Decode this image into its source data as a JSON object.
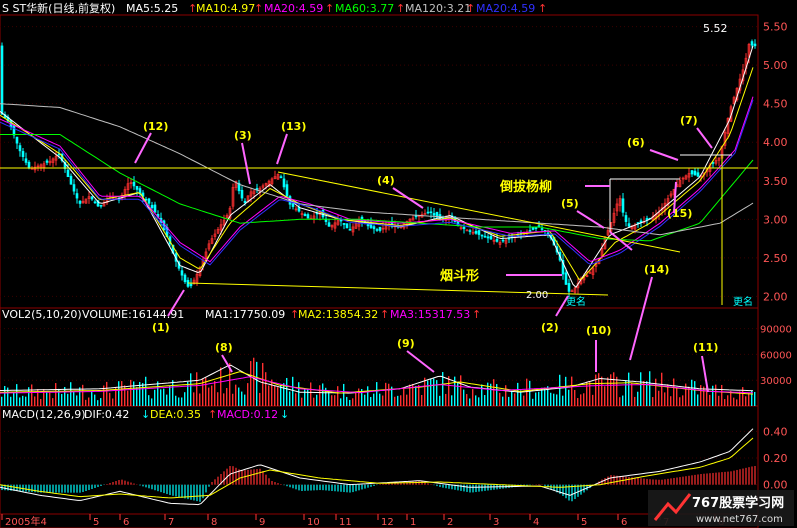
{
  "header": {
    "stock_name": "S ST华新(日线,前复权)",
    "ma5": "MA5:5.25",
    "ma10": "MA10:4.97",
    "ma20": "MA20:4.59",
    "ma60": "MA60:3.77",
    "ma120": "MA120:3.21",
    "ma20b": "MA20:4.59",
    "colors": {
      "ma5": "#ffffff",
      "ma10": "#ffff00",
      "ma20": "#ff00ff",
      "ma60": "#00ff00",
      "ma120": "#c0c0c0",
      "ma20b": "#0000ff",
      "arrow": "#ff3333"
    }
  },
  "volume_header": {
    "vol": "VOL2(5,10,20)",
    "volume": "VOLUME:16144.91",
    "ma1": "MA1:17750.09",
    "ma2": "MA2:13854.32",
    "ma3": "MA3:15317.53"
  },
  "macd_header": {
    "macd": "MACD(12,26,9)",
    "dif": "DIF:0.42",
    "dea": "DEA:0.35",
    "val": "MACD:0.12"
  },
  "annotations": {
    "a1": "(1)",
    "a2": "(2)",
    "a3": "(3)",
    "a4": "(4)",
    "a5": "(5)",
    "a6": "(6)",
    "a7": "(7)",
    "a8": "(8)",
    "a9": "(9)",
    "a10": "(10)",
    "a11": "(11)",
    "a12": "(12)",
    "a13": "(13)",
    "a14": "(14)",
    "a15": "(15)",
    "daobayangliu": "倒拔杨柳",
    "yandouxing": "烟斗形",
    "gengming": "更名",
    "low_label": "2.00",
    "high_label": "5.52"
  },
  "watermark": {
    "name": "767股票学习网",
    "url": "www.net767.com"
  },
  "chart_data": [
    {
      "type": "candlestick",
      "title": "S ST华新(日线,前复权)",
      "y_ticks": [
        "5.50",
        "5.00",
        "4.50",
        "4.00",
        "3.50",
        "3.00",
        "2.50",
        "2.00"
      ],
      "ylim": [
        1.85,
        5.65
      ],
      "x_ticks": [
        "2005年4",
        "5",
        "6",
        "7",
        "8",
        "9",
        "10",
        "11",
        "12",
        "1",
        "2",
        "3",
        "4",
        "5",
        "6",
        "7",
        "8"
      ],
      "price_path": [
        [
          0,
          4.4
        ],
        [
          10,
          4.25
        ],
        [
          20,
          3.9
        ],
        [
          30,
          3.65
        ],
        [
          40,
          3.7
        ],
        [
          50,
          3.75
        ],
        [
          60,
          3.85
        ],
        [
          70,
          3.5
        ],
        [
          80,
          3.2
        ],
        [
          90,
          3.3
        ],
        [
          100,
          3.15
        ],
        [
          110,
          3.3
        ],
        [
          120,
          3.25
        ],
        [
          130,
          3.5
        ],
        [
          140,
          3.35
        ],
        [
          150,
          3.2
        ],
        [
          160,
          3.0
        ],
        [
          170,
          2.7
        ],
        [
          175,
          2.5
        ],
        [
          180,
          2.35
        ],
        [
          185,
          2.2
        ],
        [
          190,
          2.1
        ],
        [
          200,
          2.35
        ],
        [
          210,
          2.7
        ],
        [
          220,
          2.9
        ],
        [
          230,
          3.1
        ],
        [
          235,
          3.55
        ],
        [
          240,
          3.35
        ],
        [
          245,
          3.2
        ],
        [
          250,
          3.35
        ],
        [
          260,
          3.4
        ],
        [
          270,
          3.5
        ],
        [
          280,
          3.6
        ],
        [
          290,
          3.2
        ],
        [
          300,
          3.1
        ],
        [
          310,
          3.0
        ],
        [
          320,
          3.1
        ],
        [
          330,
          2.9
        ],
        [
          340,
          3.0
        ],
        [
          350,
          2.85
        ],
        [
          360,
          3.0
        ],
        [
          370,
          2.9
        ],
        [
          380,
          2.85
        ],
        [
          390,
          2.95
        ],
        [
          400,
          2.9
        ],
        [
          410,
          3.0
        ],
        [
          420,
          3.05
        ],
        [
          430,
          3.1
        ],
        [
          440,
          3.0
        ],
        [
          450,
          3.05
        ],
        [
          460,
          2.9
        ],
        [
          470,
          2.85
        ],
        [
          480,
          2.8
        ],
        [
          490,
          2.75
        ],
        [
          500,
          2.7
        ],
        [
          510,
          2.75
        ],
        [
          520,
          2.8
        ],
        [
          530,
          2.85
        ],
        [
          540,
          2.9
        ],
        [
          550,
          2.8
        ],
        [
          560,
          2.5
        ],
        [
          565,
          2.2
        ],
        [
          570,
          2.05
        ],
        [
          575,
          2.1
        ],
        [
          580,
          2.2
        ],
        [
          590,
          2.3
        ],
        [
          600,
          2.5
        ],
        [
          605,
          2.75
        ],
        [
          610,
          2.9
        ],
        [
          615,
          3.1
        ],
        [
          620,
          3.3
        ],
        [
          625,
          3.0
        ],
        [
          630,
          2.9
        ],
        [
          640,
          2.95
        ],
        [
          650,
          3.0
        ],
        [
          660,
          3.1
        ],
        [
          670,
          3.3
        ],
        [
          680,
          3.5
        ],
        [
          690,
          3.6
        ],
        [
          700,
          3.55
        ],
        [
          705,
          3.6
        ],
        [
          710,
          3.7
        ],
        [
          720,
          3.8
        ],
        [
          725,
          4.1
        ],
        [
          730,
          4.4
        ],
        [
          735,
          4.6
        ],
        [
          740,
          4.8
        ],
        [
          745,
          5.0
        ],
        [
          750,
          5.3
        ],
        [
          753,
          5.25
        ]
      ],
      "moving_averages": [
        {
          "name": "MA5",
          "path": [
            [
              0,
              4.4
            ],
            [
              60,
              3.8
            ],
            [
              100,
              3.2
            ],
            [
              140,
              3.35
            ],
            [
              180,
              2.4
            ],
            [
              200,
              2.3
            ],
            [
              230,
              3.05
            ],
            [
              270,
              3.45
            ],
            [
              300,
              3.15
            ],
            [
              340,
              3.0
            ],
            [
              400,
              2.9
            ],
            [
              450,
              3.05
            ],
            [
              500,
              2.75
            ],
            [
              550,
              2.8
            ],
            [
              575,
              2.1
            ],
            [
              610,
              2.8
            ],
            [
              650,
              3.0
            ],
            [
              700,
              3.55
            ],
            [
              730,
              4.3
            ],
            [
              753,
              5.25
            ]
          ]
        },
        {
          "name": "MA10",
          "path": [
            [
              0,
              4.35
            ],
            [
              60,
              3.85
            ],
            [
              100,
              3.25
            ],
            [
              140,
              3.35
            ],
            [
              180,
              2.5
            ],
            [
              200,
              2.35
            ],
            [
              230,
              2.95
            ],
            [
              270,
              3.4
            ],
            [
              300,
              3.2
            ],
            [
              340,
              3.0
            ],
            [
              400,
              2.92
            ],
            [
              450,
              3.02
            ],
            [
              500,
              2.78
            ],
            [
              550,
              2.85
            ],
            [
              580,
              2.2
            ],
            [
              615,
              2.7
            ],
            [
              650,
              2.95
            ],
            [
              700,
              3.5
            ],
            [
              730,
              4.1
            ],
            [
              753,
              4.97
            ]
          ]
        },
        {
          "name": "MA20",
          "path": [
            [
              0,
              4.3
            ],
            [
              60,
              3.95
            ],
            [
              100,
              3.3
            ],
            [
              140,
              3.3
            ],
            [
              180,
              2.7
            ],
            [
              210,
              2.45
            ],
            [
              240,
              2.9
            ],
            [
              280,
              3.3
            ],
            [
              310,
              3.2
            ],
            [
              350,
              3.0
            ],
            [
              400,
              2.95
            ],
            [
              450,
              3.0
            ],
            [
              510,
              2.82
            ],
            [
              555,
              2.85
            ],
            [
              590,
              2.45
            ],
            [
              620,
              2.6
            ],
            [
              660,
              2.95
            ],
            [
              700,
              3.4
            ],
            [
              735,
              3.9
            ],
            [
              753,
              4.59
            ]
          ]
        },
        {
          "name": "MA60",
          "path": [
            [
              0,
              4.1
            ],
            [
              60,
              4.1
            ],
            [
              120,
              3.6
            ],
            [
              180,
              3.2
            ],
            [
              240,
              2.95
            ],
            [
              300,
              3.0
            ],
            [
              360,
              3.0
            ],
            [
              420,
              2.95
            ],
            [
              480,
              2.9
            ],
            [
              540,
              2.9
            ],
            [
              600,
              2.75
            ],
            [
              650,
              2.72
            ],
            [
              700,
              2.95
            ],
            [
              753,
              3.77
            ]
          ]
        },
        {
          "name": "MA120",
          "path": [
            [
              0,
              4.5
            ],
            [
              60,
              4.45
            ],
            [
              120,
              4.2
            ],
            [
              180,
              3.85
            ],
            [
              240,
              3.45
            ],
            [
              300,
              3.2
            ],
            [
              360,
              3.1
            ],
            [
              420,
              3.05
            ],
            [
              480,
              3.0
            ],
            [
              540,
              2.95
            ],
            [
              600,
              2.9
            ],
            [
              660,
              2.8
            ],
            [
              720,
              2.95
            ],
            [
              753,
              3.21
            ]
          ]
        }
      ]
    },
    {
      "type": "bar",
      "title": "VOL2(5,10,20)",
      "y_ticks": [
        "90000",
        "60000",
        "30000"
      ],
      "ylim": [
        0,
        100000
      ],
      "series": [
        {
          "name": "MA1",
          "path": [
            [
              0,
              18000
            ],
            [
              100,
              20000
            ],
            [
              200,
              30000
            ],
            [
              230,
              48000
            ],
            [
              260,
              28000
            ],
            [
              300,
              16000
            ],
            [
              350,
              15000
            ],
            [
              400,
              20000
            ],
            [
              440,
              35000
            ],
            [
              470,
              22000
            ],
            [
              520,
              16000
            ],
            [
              570,
              22000
            ],
            [
              600,
              32000
            ],
            [
              640,
              28000
            ],
            [
              700,
              20000
            ],
            [
              753,
              17750
            ]
          ]
        },
        {
          "name": "MA2",
          "path": [
            [
              0,
              16000
            ],
            [
              100,
              18000
            ],
            [
              200,
              26000
            ],
            [
              240,
              40000
            ],
            [
              280,
              24000
            ],
            [
              340,
              15000
            ],
            [
              420,
              22000
            ],
            [
              460,
              28000
            ],
            [
              520,
              17000
            ],
            [
              590,
              26000
            ],
            [
              630,
              27000
            ],
            [
              700,
              18000
            ],
            [
              753,
              13854
            ]
          ]
        },
        {
          "name": "MA3",
          "path": [
            [
              0,
              15000
            ],
            [
              100,
              17000
            ],
            [
              200,
              24000
            ],
            [
              250,
              34000
            ],
            [
              300,
              20000
            ],
            [
              360,
              15500
            ],
            [
              440,
              25000
            ],
            [
              500,
              18000
            ],
            [
              600,
              24000
            ],
            [
              650,
              25000
            ],
            [
              710,
              17000
            ],
            [
              753,
              15317
            ]
          ]
        }
      ],
      "last_volume": 16144.91
    },
    {
      "type": "bar",
      "title": "MACD(12,26,9)",
      "y_ticks": [
        "0.40",
        "0.20",
        "0.00"
      ],
      "ylim": [
        -0.22,
        0.5
      ],
      "series": [
        {
          "name": "DIF",
          "path": [
            [
              0,
              -0.02
            ],
            [
              40,
              -0.08
            ],
            [
              80,
              -0.12
            ],
            [
              120,
              -0.05
            ],
            [
              170,
              -0.14
            ],
            [
              200,
              -0.15
            ],
            [
              230,
              0.08
            ],
            [
              260,
              0.15
            ],
            [
              300,
              0.05
            ],
            [
              350,
              0.0
            ],
            [
              420,
              0.03
            ],
            [
              470,
              -0.02
            ],
            [
              540,
              -0.01
            ],
            [
              570,
              -0.08
            ],
            [
              610,
              0.05
            ],
            [
              660,
              0.1
            ],
            [
              700,
              0.17
            ],
            [
              730,
              0.25
            ],
            [
              753,
              0.42
            ]
          ]
        },
        {
          "name": "DEA",
          "path": [
            [
              0,
              0.0
            ],
            [
              40,
              -0.05
            ],
            [
              80,
              -0.09
            ],
            [
              120,
              -0.07
            ],
            [
              170,
              -0.1
            ],
            [
              210,
              -0.08
            ],
            [
              240,
              0.05
            ],
            [
              270,
              0.11
            ],
            [
              320,
              0.05
            ],
            [
              380,
              0.01
            ],
            [
              440,
              0.02
            ],
            [
              500,
              0.0
            ],
            [
              560,
              -0.02
            ],
            [
              600,
              0.0
            ],
            [
              650,
              0.07
            ],
            [
              700,
              0.13
            ],
            [
              730,
              0.2
            ],
            [
              753,
              0.35
            ]
          ]
        }
      ]
    }
  ]
}
